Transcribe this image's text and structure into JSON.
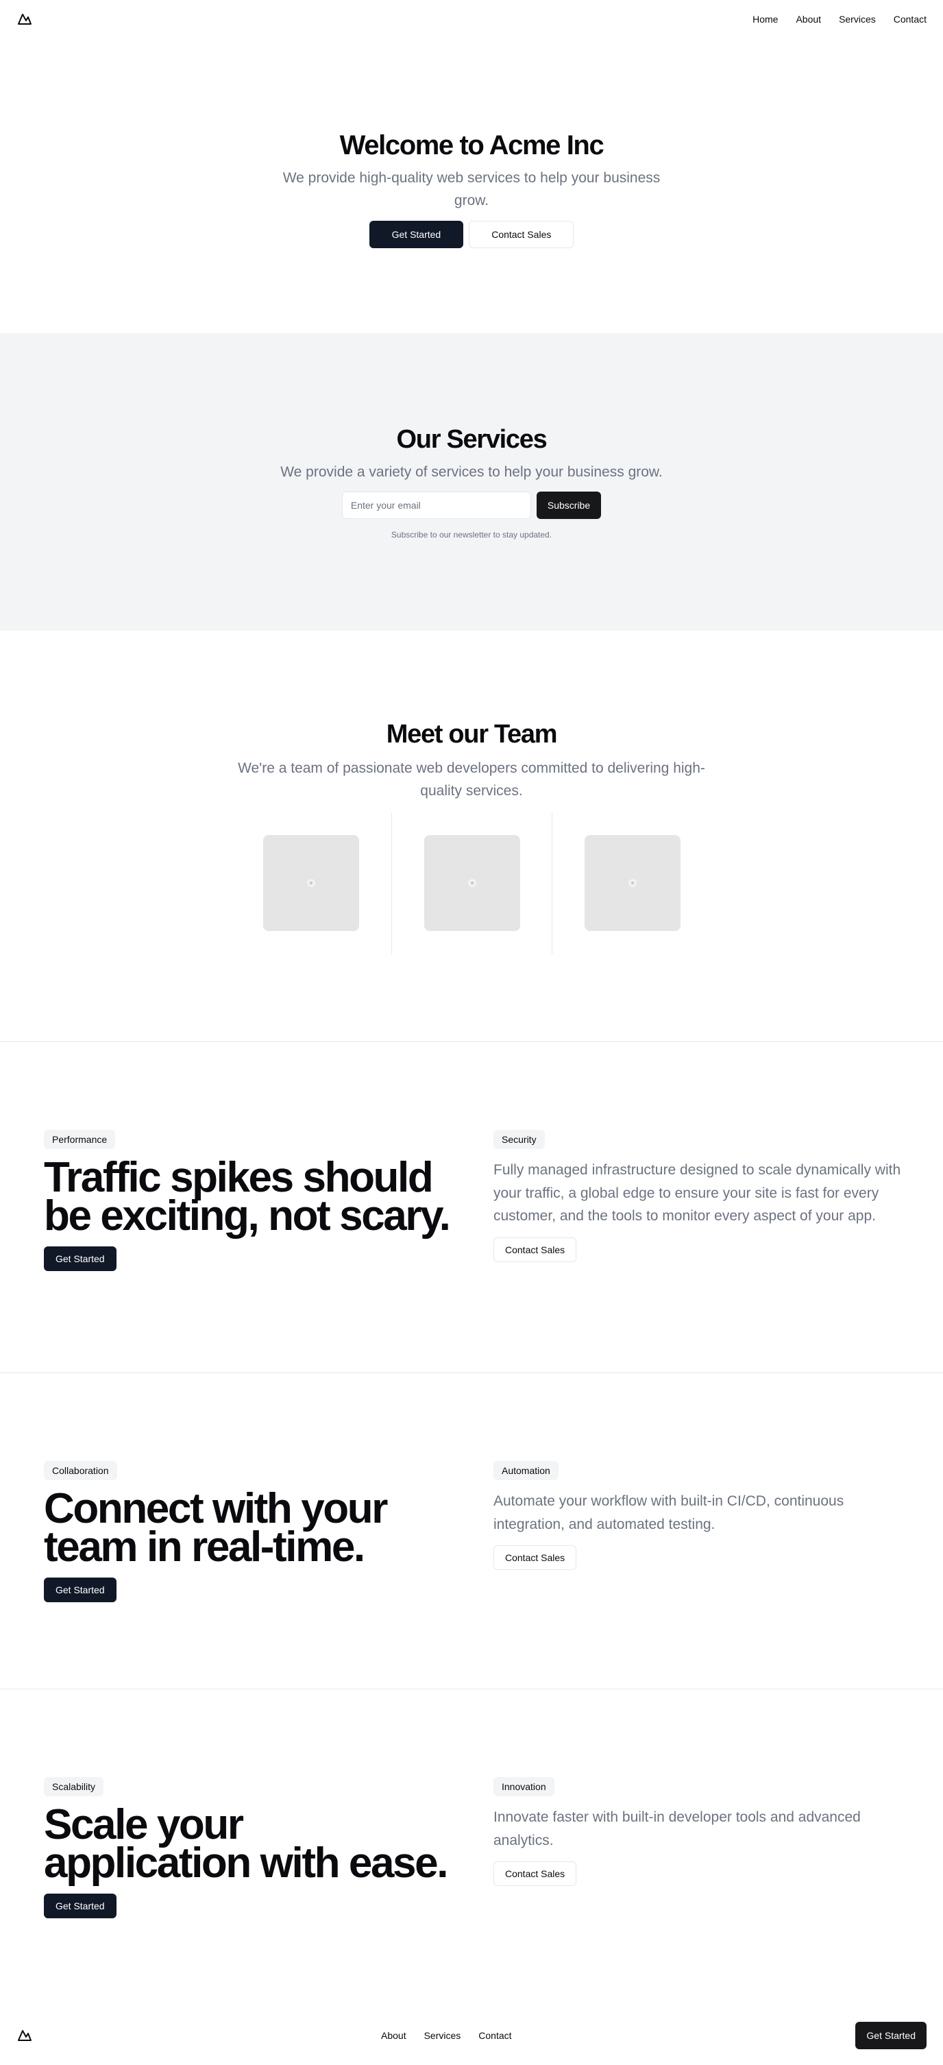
{
  "nav": {
    "items": [
      "Home",
      "About",
      "Services",
      "Contact"
    ]
  },
  "hero": {
    "title": "Welcome to Acme Inc",
    "subtitle": "We provide high-quality web services to help your business grow.",
    "primary_label": "Get Started",
    "secondary_label": "Contact Sales"
  },
  "services": {
    "title": "Our Services",
    "subtitle": "We provide a variety of services to help your business grow.",
    "email_placeholder": "Enter your email",
    "subscribe_label": "Subscribe",
    "note": "Subscribe to our newsletter to stay updated."
  },
  "team": {
    "title": "Meet our Team",
    "subtitle": "We're a team of passionate web developers committed to delivering high-quality services."
  },
  "features": [
    {
      "left_badge": "Performance",
      "headline": "Traffic spikes should be exciting, not scary.",
      "left_button": "Get Started",
      "right_badge": "Security",
      "description": "Fully managed infrastructure designed to scale dynamically with your traffic, a global edge to ensure your site is fast for every customer, and the tools to monitor every aspect of your app.",
      "right_button": "Contact Sales"
    },
    {
      "left_badge": "Collaboration",
      "headline": "Connect with your team in real-time.",
      "left_button": "Get Started",
      "right_badge": "Automation",
      "description": "Automate your workflow with built-in CI/CD, continuous integration, and automated testing.",
      "right_button": "Contact Sales"
    },
    {
      "left_badge": "Scalability",
      "headline": "Scale your application with ease.",
      "left_button": "Get Started",
      "right_badge": "Innovation",
      "description": "Innovate faster with built-in developer tools and advanced analytics.",
      "right_button": "Contact Sales"
    }
  ],
  "footer": {
    "items": [
      "About",
      "Services",
      "Contact"
    ],
    "cta_label": "Get Started"
  },
  "icons": {
    "logo": "mountain-logo-icon",
    "avatar_placeholder": "image-placeholder-icon"
  }
}
